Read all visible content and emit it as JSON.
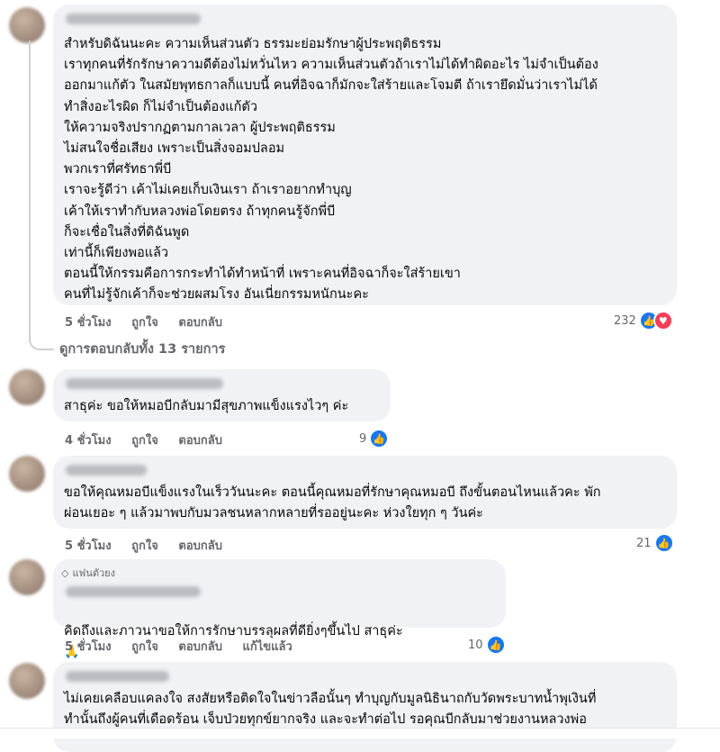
{
  "comments": [
    {
      "body": "สำหรับดิฉันนะคะ ความเห็นส่วนตัว ธรรมะย่อมรักษาผู้ประพฤติธรรม\nเราทุกคนที่รักรักษาความดีต้องไม่หวั่นไหว ความเห็นส่วนตัวถ้าเราไม่ได้ทำผิดอะไร ไม่จำเป็นต้อง\nออกมาแก้ตัว ในสมัยพุทธกาลก็แบบนี้ คนที่อิจฉาก็มักจะใส่ร้ายและโจมตี ถ้าเรายึดมั่นว่าเราไม่ได้\nทำสิ่งอะไรผิด ก็ไม่จำเป็นต้องแก้ตัว\nให้ความจริงปรากฏตามกาลเวลา ผู้ประพฤติธรรม\nไม่สนใจชื่อเสียง เพราะเป็นสิ่งจอมปลอม\nพวกเราที่ศรัทธาพี่บี\nเราจะรู้ดีว่า เค้าไม่เคยเก็บเงินเรา ถ้าเราอยากทำบุญ\nเค้าให้เราทำกับหลวงพ่อโดยตรง ถ้าทุกคนรู้จักพี่บี\nก็จะเชื่อในสิ่งที่ดิฉันพูด\nเท่านี้ก็เพียงพอแล้ว\nตอนนี้ให้กรรมคือการกระทำได้ทำหน้าที่ เพราะคนที่อิจฉาก็จะใส่ร้ายเขา\nคนที่ไม่รู้จักเค้าก็จะช่วยผสมโรง อันเนี่ยกรรมหนักนะคะ",
      "time": "5 ชั่วโมง",
      "like": "ถูกใจ",
      "reply": "ตอบกลับ",
      "count": "232"
    },
    {
      "body": "สาธุค่ะ ขอให้หมอบีกลับมามีสุขภาพแข็งแรงไวๆ ค่ะ",
      "time": "4 ชั่วโมง",
      "like": "ถูกใจ",
      "reply": "ตอบกลับ",
      "count": "9"
    },
    {
      "body": "ขอให้คุณหมอบีแข็งแรงในเร็ววันนะคะ ตอนนี้คุณหมอที่รักษาคุณหมอบี ถึงขั้นตอนไหนแล้วคะ พัก\nผ่อนเยอะ ๆ แล้วมาพบกับมวลชนหลากหลายที่รออยู่นะคะ ห่วงใยทุก ๆ วันค่ะ",
      "time": "5 ชั่วโมง",
      "like": "ถูกใจ",
      "reply": "ตอบกลับ",
      "count": "21"
    },
    {
      "badge": "แฟนตัวยง",
      "body": "คิดถึงและภาวนาขอให้การรักษาบรรลุผลที่ดียิ่งๆขึ้นไป สาธุค่ะ",
      "time": "5 ชั่วโมง",
      "like": "ถูกใจ",
      "reply": "ตอบกลับ",
      "edited": "แก้ไขแล้ว",
      "count": "10"
    },
    {
      "body": "ไม่เคยเคลือบแคลงใจ สงสัยหรือติดใจในข่าวลือนั้นๆ ทำบุญกับมูลนิธินาถกับวัดพระบาทน้ำพุเงินที่\nทำนั้นถึงผู้คนที่เดือดร้อน เจ็บป่วยทุกข์ยากจริง และจะทำต่อไป รอคุณบีกลับมาช่วยงานหลวงพ่อ"
    }
  ],
  "view_replies": "ดูการตอบกลับทั้ง 13 รายการ",
  "icons": {
    "like": "like-icon",
    "love": "love-icon",
    "fan": "diamond-icon"
  },
  "colors": {
    "like_blue": "#1877f2",
    "love_red": "#f33e58",
    "bubble": "#f0f2f5",
    "meta": "#65676b"
  }
}
